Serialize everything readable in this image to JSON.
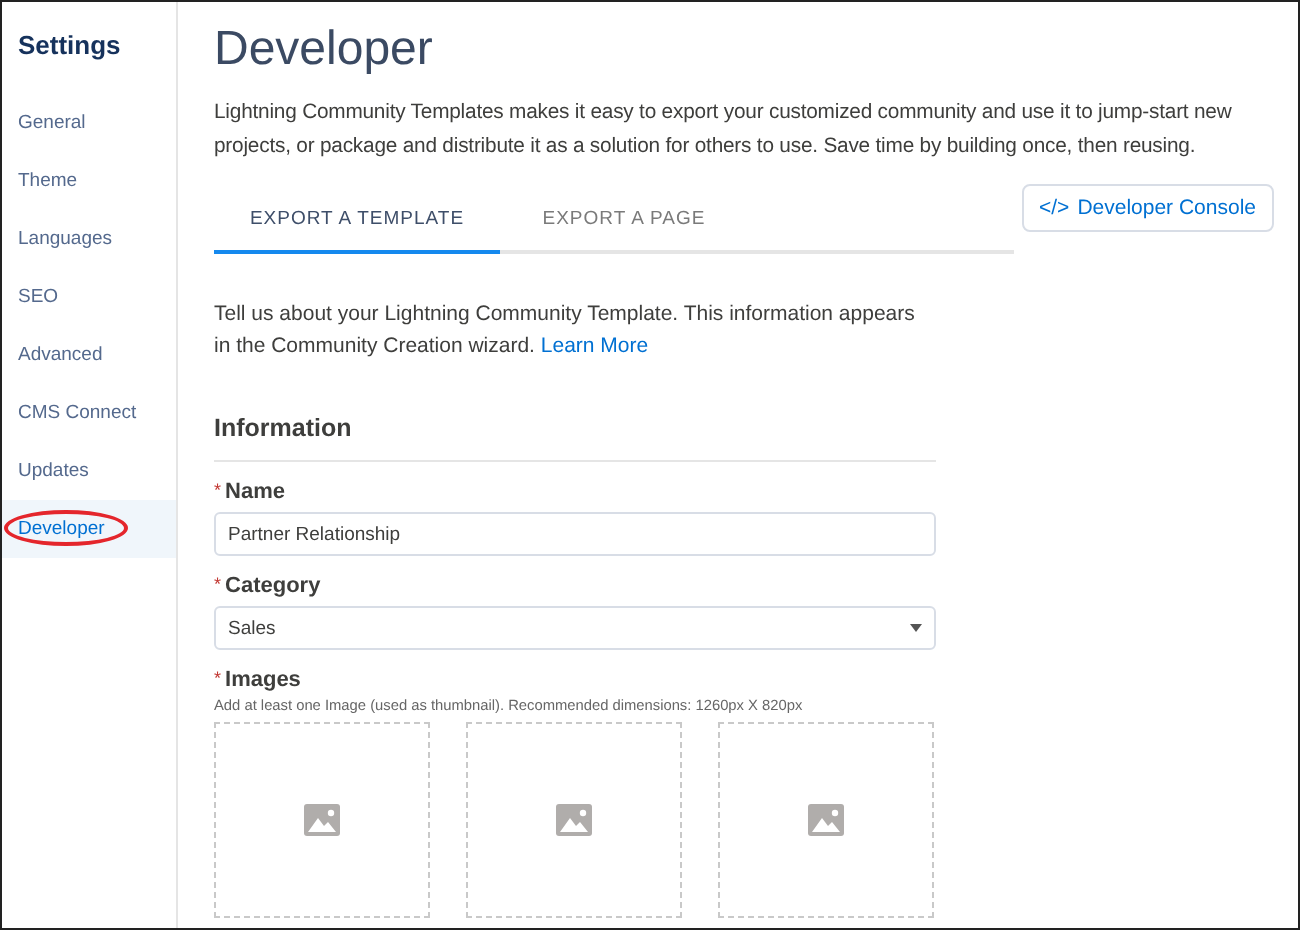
{
  "sidebar": {
    "title": "Settings",
    "items": [
      {
        "label": "General",
        "selected": false,
        "circled": false
      },
      {
        "label": "Theme",
        "selected": false,
        "circled": false
      },
      {
        "label": "Languages",
        "selected": false,
        "circled": false
      },
      {
        "label": "SEO",
        "selected": false,
        "circled": false
      },
      {
        "label": "Advanced",
        "selected": false,
        "circled": false
      },
      {
        "label": "CMS Connect",
        "selected": false,
        "circled": false
      },
      {
        "label": "Updates",
        "selected": false,
        "circled": false
      },
      {
        "label": "Developer",
        "selected": true,
        "circled": true
      }
    ]
  },
  "page": {
    "title": "Developer",
    "description": "Lightning Community Templates makes it easy to export your customized community and use it to jump-start new projects, or package and distribute it as a solution for others to use. Save time by building once, then reusing."
  },
  "tabs": [
    {
      "label": "EXPORT A TEMPLATE",
      "selected": true
    },
    {
      "label": "EXPORT A PAGE",
      "selected": false
    }
  ],
  "console_button": {
    "icon": "</>",
    "label": "Developer Console"
  },
  "intro": {
    "text": "Tell us about your Lightning Community Template. This information appears in the Community Creation wizard.",
    "link": "Learn More"
  },
  "section": {
    "title": "Information"
  },
  "fields": [
    {
      "kind": "text",
      "label": "Name",
      "required_marker": "*",
      "value": "Partner Relationship"
    },
    {
      "kind": "select",
      "label": "Category",
      "required_marker": "*",
      "value": "Sales"
    },
    {
      "kind": "images",
      "label": "Images",
      "required_marker": "*",
      "help": "Add at least one Image (used as thumbnail). Recommended dimensions: 1260px X 820px"
    }
  ]
}
